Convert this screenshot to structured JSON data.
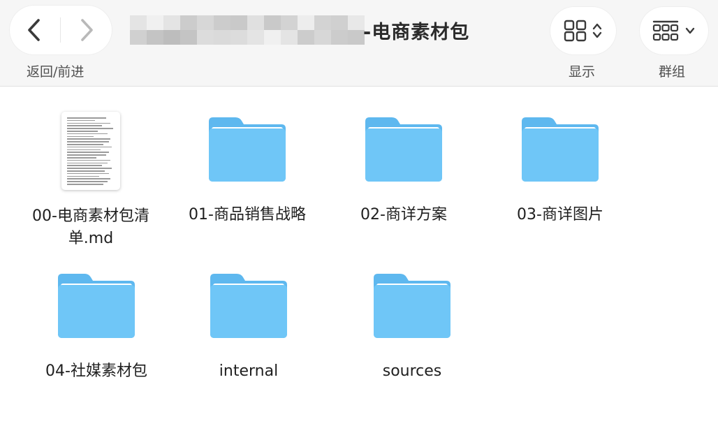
{
  "toolbar": {
    "back_forward_label": "返回/前进",
    "title_suffix": "-电商素材包",
    "view_label": "显示",
    "group_label": "群组"
  },
  "files": [
    {
      "name_line1": "00-电商素材包清",
      "name_line2": "单.md",
      "icon": "markdown-document-icon"
    },
    {
      "name": "01-商品销售战略",
      "icon": "folder-icon"
    },
    {
      "name": "02-商详方案",
      "icon": "folder-icon"
    },
    {
      "name": "03-商详图片",
      "icon": "folder-icon"
    },
    {
      "name": "04-社媒素材包",
      "icon": "folder-icon"
    },
    {
      "name": "internal",
      "icon": "folder-icon"
    },
    {
      "name": "sources",
      "icon": "folder-icon"
    }
  ],
  "colors": {
    "folder_back": "#5eb8ef",
    "folder_front": "#6fc6f7",
    "toolbar_bg": "#f6f6f6"
  }
}
